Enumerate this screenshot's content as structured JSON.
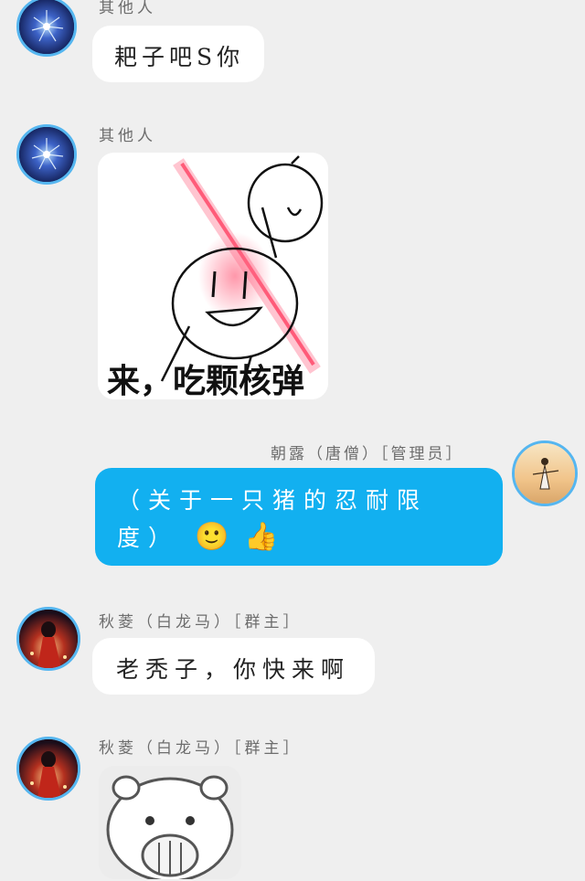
{
  "messages": [
    {
      "sender": "其他人",
      "text": "耙子吧S你"
    },
    {
      "sender": "其他人",
      "sticker_caption": "来，吃颗核弹"
    },
    {
      "sender": "朝露（唐僧）［管理员］",
      "text_line1": "（关于一只猪的忍耐限",
      "text_line2": "度）",
      "emoji1": "🙂",
      "emoji2": "👍"
    },
    {
      "sender": "秋菱（白龙马）［群主］",
      "text": "老秃子，你快来啊"
    },
    {
      "sender": "秋菱（白龙马）［群主］",
      "sticker": "polar-bear-covering-mouth"
    }
  ],
  "colors": {
    "background": "#efefef",
    "blue_bubble": "#12b0f0",
    "avatar_ring": "#55b6f0",
    "name_text": "#6d6d6d"
  }
}
